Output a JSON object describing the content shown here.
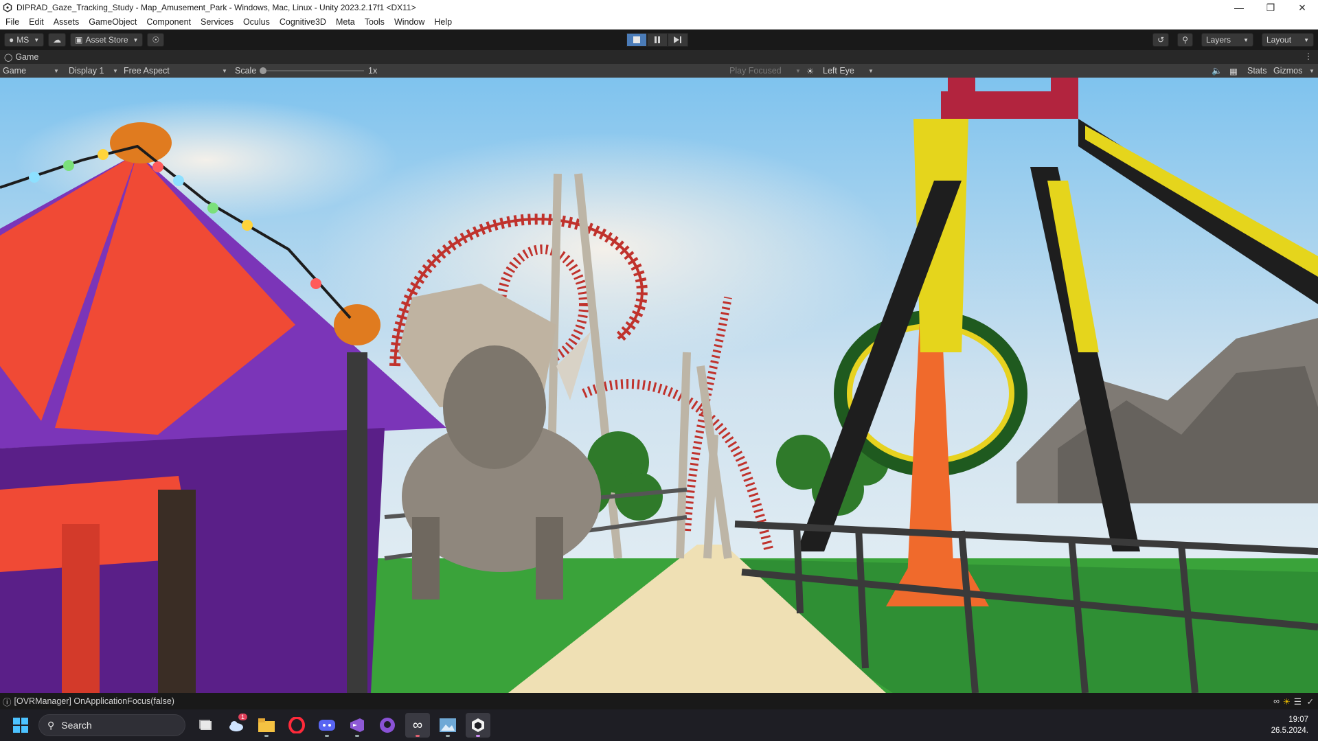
{
  "window": {
    "title": "DIPRAD_Gaze_Tracking_Study - Map_Amusement_Park - Windows, Mac, Linux - Unity 2023.2.17f1 <DX11>",
    "controls": [
      "minimize-icon",
      "maximize-icon",
      "close-icon"
    ]
  },
  "menu": [
    "File",
    "Edit",
    "Assets",
    "GameObject",
    "Component",
    "Services",
    "Oculus",
    "Cognitive3D",
    "Meta",
    "Tools",
    "Window",
    "Help"
  ],
  "toolbar": {
    "account_label": "MS",
    "asset_store_label": "Asset Store",
    "layers_label": "Layers",
    "layout_label": "Layout",
    "play_state": "playing"
  },
  "tab": {
    "label": "Game"
  },
  "game_toolbar": {
    "view_mode": "Game",
    "display": "Display 1",
    "aspect": "Free Aspect",
    "scale_label": "Scale",
    "scale_value": "1x",
    "play_focused": "Play Focused",
    "eye": "Left Eye",
    "stats_label": "Stats",
    "gizmos_label": "Gizmos"
  },
  "status": {
    "message": "[OVRManager] OnApplicationFocus(false)"
  },
  "taskbar": {
    "search_placeholder": "Search",
    "weather_badge": "1",
    "apps": [
      "start-icon",
      "search-icon",
      "task-view-icon",
      "weather-icon",
      "file-explorer-icon",
      "opera-icon",
      "discord-icon",
      "visual-studio-icon",
      "github-desktop-icon",
      "meta-quest-link-icon",
      "photos-icon",
      "unity-hub-icon"
    ],
    "time": "19:07",
    "date": "26.5.2024."
  },
  "colors": {
    "accent": "#4b7cb8",
    "editor_bg": "#191919",
    "tent_red": "#f04a35",
    "tent_purple": "#7b35b8",
    "track_red": "#c0322c",
    "sky": "#7fc3ee"
  }
}
